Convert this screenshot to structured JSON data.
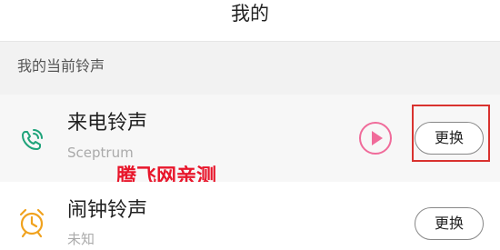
{
  "header": {
    "title": "我的"
  },
  "section": {
    "label": "我的当前铃声"
  },
  "ringtones": [
    {
      "title": "来电铃声",
      "subtitle": "Sceptrum",
      "icon": "phone-ringing-icon",
      "change_label": "更换"
    },
    {
      "title": "闹钟铃声",
      "subtitle": "未知",
      "icon": "alarm-clock-icon",
      "change_label": "更换"
    }
  ],
  "watermark": {
    "text": "腾飞网亲测"
  },
  "colors": {
    "phone_icon": "#1fa37a",
    "alarm_icon": "#f0a21e",
    "play_accent": "#f06b9a",
    "highlight": "#d9322f",
    "watermark": "#e8162b"
  }
}
